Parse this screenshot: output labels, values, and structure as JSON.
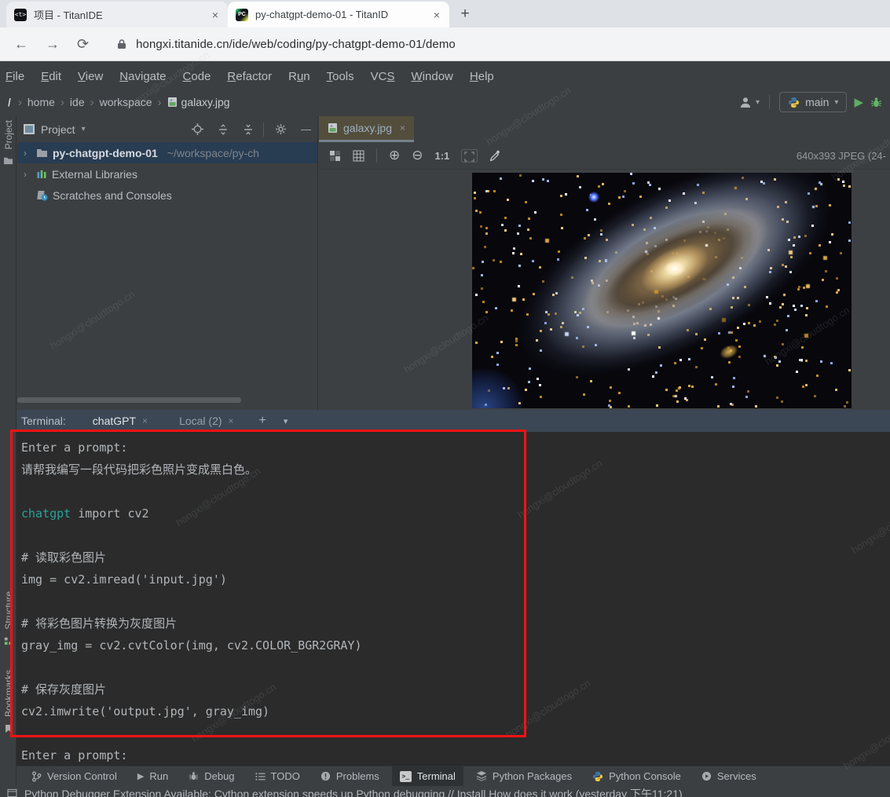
{
  "browser": {
    "tabs": [
      {
        "title": "项目 - TitanIDE",
        "favicon": "titanide"
      },
      {
        "title": "py-chatgpt-demo-01 - TitanID",
        "favicon": "pycharm"
      }
    ],
    "favicon_t_glyph": "<t>",
    "favicon_pc_glyph": "PC",
    "url": "hongxi.titanide.cn/ide/web/coding/py-chatgpt-demo-01/demo"
  },
  "icons": {
    "close": "×",
    "plus": "+",
    "new_tab": "+",
    "back": "←",
    "forward": "→",
    "reload": "⟳",
    "caret_down": "▾",
    "run": "▶",
    "sep": "›",
    "expander": "›",
    "minimize": "—",
    "terminal_glyph": ">_"
  },
  "menu": {
    "items": [
      {
        "pre": "",
        "mn": "F",
        "post": "ile"
      },
      {
        "pre": "",
        "mn": "E",
        "post": "dit"
      },
      {
        "pre": "",
        "mn": "V",
        "post": "iew"
      },
      {
        "pre": "",
        "mn": "N",
        "post": "avigate"
      },
      {
        "pre": "",
        "mn": "C",
        "post": "ode"
      },
      {
        "pre": "",
        "mn": "R",
        "post": "efactor"
      },
      {
        "pre": "R",
        "mn": "u",
        "post": "n"
      },
      {
        "pre": "",
        "mn": "T",
        "post": "ools"
      },
      {
        "pre": "VC",
        "mn": "S",
        "post": ""
      },
      {
        "pre": "",
        "mn": "W",
        "post": "indow"
      },
      {
        "pre": "",
        "mn": "H",
        "post": "elp"
      }
    ]
  },
  "breadcrumbs": {
    "root": "/",
    "items": [
      "home",
      "ide",
      "workspace"
    ],
    "file": "galaxy.jpg"
  },
  "run_widget": {
    "branch": "main"
  },
  "project": {
    "title": "Project",
    "tree": [
      {
        "name": "py-chatgpt-demo-01",
        "path": "~/workspace/py-ch"
      },
      {
        "name": "External Libraries"
      },
      {
        "name": "Scratches and Consoles"
      }
    ]
  },
  "editor": {
    "tab": "galaxy.jpg",
    "actual_size": "1:1",
    "info": "640x393 JPEG (24-"
  },
  "terminal": {
    "label": "Terminal:",
    "tabs": [
      "chatGPT",
      "Local (2)"
    ],
    "lines": [
      "Enter a prompt:",
      "请帮我编写一段代码把彩色照片变成黑白色。",
      "",
      "",
      "",
      "# 读取彩色图片",
      "img = cv2.imread('input.jpg')",
      "",
      "# 将彩色图片转换为灰度图片",
      "gray_img = cv2.cvtColor(img, cv2.COLOR_BGR2GRAY)",
      "",
      "# 保存灰度图片",
      "cv2.imwrite('output.jpg', gray_img)",
      "",
      "Enter a prompt:"
    ],
    "chatgpt_keyword": "chatgpt",
    "chatgpt_rest": " import cv2"
  },
  "statusbar": {
    "items": [
      "Version Control",
      "Run",
      "Debug",
      "TODO",
      "Problems",
      "Terminal",
      "Python Packages",
      "Python Console",
      "Services"
    ]
  },
  "stripe": {
    "top": "Project",
    "middle": "Structure",
    "bottom": "Bookmarks"
  },
  "notification": "Python Debugger Extension Available: Cython extension speeds up Python debugging // Install   How does it work (yesterday 下午11:21)",
  "watermark": "hongxi@cloudtogo.cn",
  "colors": {
    "annotation_red": "#f51313",
    "terminal_teal": "#2aa198",
    "run_green": "#5fad65",
    "tab_underline": "#73828f",
    "selection_blue": "#283c52",
    "terminal_header": "#3b4754"
  }
}
